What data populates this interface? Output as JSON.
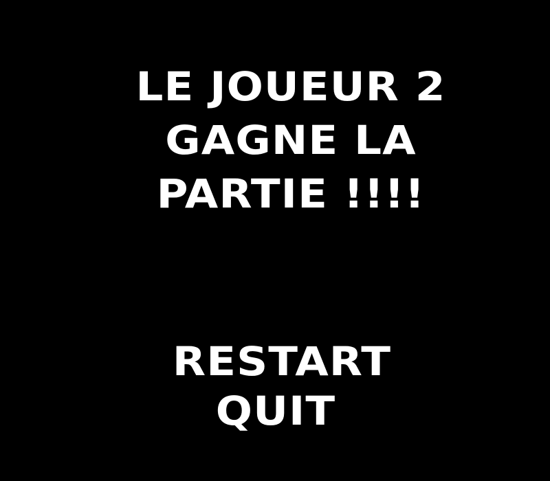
{
  "game_over": {
    "message_lines": [
      "LE JOUEUR 2",
      "GAGNE LA",
      "PARTIE !!!!"
    ]
  },
  "menu": {
    "restart_label": "RESTART",
    "quit_label": "QUIT"
  },
  "colors": {
    "background": "#000000",
    "text": "#ffffff"
  }
}
